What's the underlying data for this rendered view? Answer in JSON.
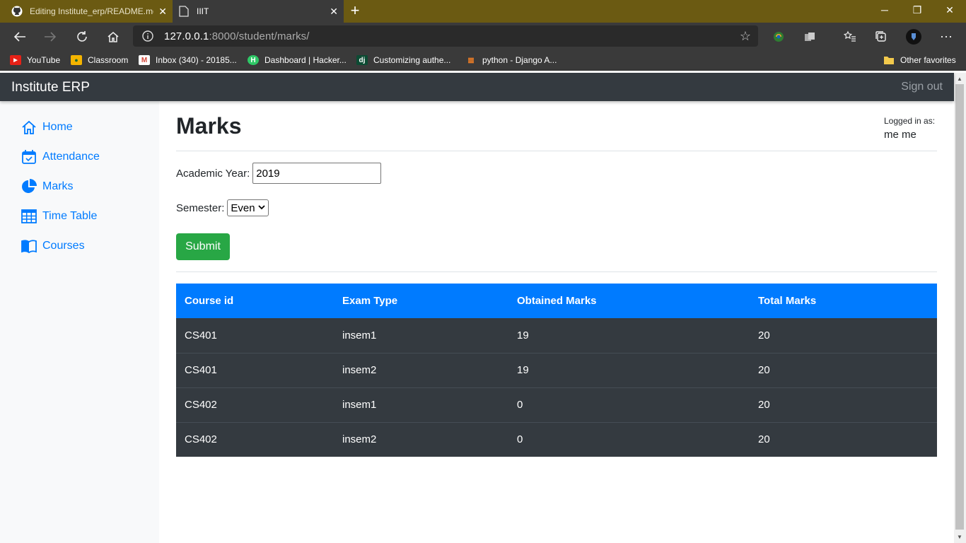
{
  "browser": {
    "tabs": [
      {
        "title": "Editing Institute_erp/README.md",
        "icon": "github-icon"
      },
      {
        "title": "IIIT",
        "icon": "page-icon"
      }
    ],
    "url_host": "127.0.0.1",
    "url_path": ":8000/student/marks/",
    "bookmarks": [
      {
        "label": "YouTube"
      },
      {
        "label": "Classroom"
      },
      {
        "label": "Inbox (340) - 20185..."
      },
      {
        "label": "Dashboard | Hacker..."
      },
      {
        "label": "Customizing authe..."
      },
      {
        "label": "python - Django A..."
      }
    ],
    "other_favorites": "Other favorites"
  },
  "app": {
    "brand": "Institute ERP",
    "sign_out": "Sign out",
    "sidebar": [
      {
        "label": "Home",
        "icon": "home-icon"
      },
      {
        "label": "Attendance",
        "icon": "calendar-icon"
      },
      {
        "label": "Marks",
        "icon": "pie-chart-icon"
      },
      {
        "label": "Time Table",
        "icon": "grid-icon"
      },
      {
        "label": "Courses",
        "icon": "book-icon"
      }
    ],
    "page_title": "Marks",
    "logged_in_label": "Logged in as:",
    "logged_in_user": "me me",
    "form": {
      "academic_year_label": "Academic Year:",
      "academic_year_value": "2019",
      "semester_label": "Semester:",
      "semester_value": "Even",
      "submit_label": "Submit"
    },
    "table": {
      "headers": [
        "Course id",
        "Exam Type",
        "Obtained Marks",
        "Total Marks"
      ],
      "rows": [
        [
          "CS401",
          "insem1",
          "19",
          "20"
        ],
        [
          "CS401",
          "insem2",
          "19",
          "20"
        ],
        [
          "CS402",
          "insem1",
          "0",
          "20"
        ],
        [
          "CS402",
          "insem2",
          "0",
          "20"
        ]
      ]
    }
  },
  "colors": {
    "primary": "#007bff",
    "success": "#28a745",
    "dark": "#343a40",
    "tabbar": "#6b5a12"
  }
}
